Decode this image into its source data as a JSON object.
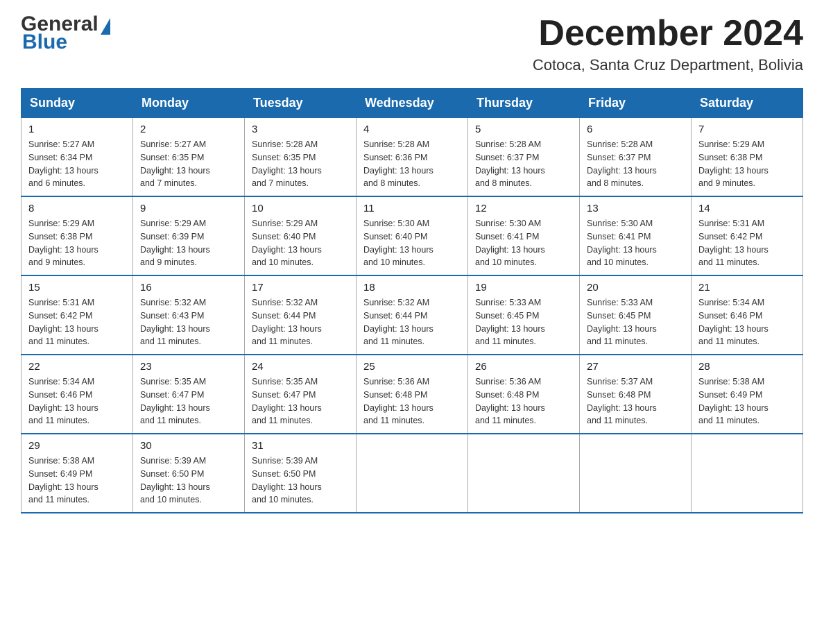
{
  "header": {
    "logo_general": "General",
    "logo_blue": "Blue",
    "title": "December 2024",
    "subtitle": "Cotoca, Santa Cruz Department, Bolivia"
  },
  "weekdays": [
    "Sunday",
    "Monday",
    "Tuesday",
    "Wednesday",
    "Thursday",
    "Friday",
    "Saturday"
  ],
  "weeks": [
    [
      {
        "day": "1",
        "sunrise": "5:27 AM",
        "sunset": "6:34 PM",
        "daylight": "13 hours and 6 minutes."
      },
      {
        "day": "2",
        "sunrise": "5:27 AM",
        "sunset": "6:35 PM",
        "daylight": "13 hours and 7 minutes."
      },
      {
        "day": "3",
        "sunrise": "5:28 AM",
        "sunset": "6:35 PM",
        "daylight": "13 hours and 7 minutes."
      },
      {
        "day": "4",
        "sunrise": "5:28 AM",
        "sunset": "6:36 PM",
        "daylight": "13 hours and 8 minutes."
      },
      {
        "day": "5",
        "sunrise": "5:28 AM",
        "sunset": "6:37 PM",
        "daylight": "13 hours and 8 minutes."
      },
      {
        "day": "6",
        "sunrise": "5:28 AM",
        "sunset": "6:37 PM",
        "daylight": "13 hours and 8 minutes."
      },
      {
        "day": "7",
        "sunrise": "5:29 AM",
        "sunset": "6:38 PM",
        "daylight": "13 hours and 9 minutes."
      }
    ],
    [
      {
        "day": "8",
        "sunrise": "5:29 AM",
        "sunset": "6:38 PM",
        "daylight": "13 hours and 9 minutes."
      },
      {
        "day": "9",
        "sunrise": "5:29 AM",
        "sunset": "6:39 PM",
        "daylight": "13 hours and 9 minutes."
      },
      {
        "day": "10",
        "sunrise": "5:29 AM",
        "sunset": "6:40 PM",
        "daylight": "13 hours and 10 minutes."
      },
      {
        "day": "11",
        "sunrise": "5:30 AM",
        "sunset": "6:40 PM",
        "daylight": "13 hours and 10 minutes."
      },
      {
        "day": "12",
        "sunrise": "5:30 AM",
        "sunset": "6:41 PM",
        "daylight": "13 hours and 10 minutes."
      },
      {
        "day": "13",
        "sunrise": "5:30 AM",
        "sunset": "6:41 PM",
        "daylight": "13 hours and 10 minutes."
      },
      {
        "day": "14",
        "sunrise": "5:31 AM",
        "sunset": "6:42 PM",
        "daylight": "13 hours and 11 minutes."
      }
    ],
    [
      {
        "day": "15",
        "sunrise": "5:31 AM",
        "sunset": "6:42 PM",
        "daylight": "13 hours and 11 minutes."
      },
      {
        "day": "16",
        "sunrise": "5:32 AM",
        "sunset": "6:43 PM",
        "daylight": "13 hours and 11 minutes."
      },
      {
        "day": "17",
        "sunrise": "5:32 AM",
        "sunset": "6:44 PM",
        "daylight": "13 hours and 11 minutes."
      },
      {
        "day": "18",
        "sunrise": "5:32 AM",
        "sunset": "6:44 PM",
        "daylight": "13 hours and 11 minutes."
      },
      {
        "day": "19",
        "sunrise": "5:33 AM",
        "sunset": "6:45 PM",
        "daylight": "13 hours and 11 minutes."
      },
      {
        "day": "20",
        "sunrise": "5:33 AM",
        "sunset": "6:45 PM",
        "daylight": "13 hours and 11 minutes."
      },
      {
        "day": "21",
        "sunrise": "5:34 AM",
        "sunset": "6:46 PM",
        "daylight": "13 hours and 11 minutes."
      }
    ],
    [
      {
        "day": "22",
        "sunrise": "5:34 AM",
        "sunset": "6:46 PM",
        "daylight": "13 hours and 11 minutes."
      },
      {
        "day": "23",
        "sunrise": "5:35 AM",
        "sunset": "6:47 PM",
        "daylight": "13 hours and 11 minutes."
      },
      {
        "day": "24",
        "sunrise": "5:35 AM",
        "sunset": "6:47 PM",
        "daylight": "13 hours and 11 minutes."
      },
      {
        "day": "25",
        "sunrise": "5:36 AM",
        "sunset": "6:48 PM",
        "daylight": "13 hours and 11 minutes."
      },
      {
        "day": "26",
        "sunrise": "5:36 AM",
        "sunset": "6:48 PM",
        "daylight": "13 hours and 11 minutes."
      },
      {
        "day": "27",
        "sunrise": "5:37 AM",
        "sunset": "6:48 PM",
        "daylight": "13 hours and 11 minutes."
      },
      {
        "day": "28",
        "sunrise": "5:38 AM",
        "sunset": "6:49 PM",
        "daylight": "13 hours and 11 minutes."
      }
    ],
    [
      {
        "day": "29",
        "sunrise": "5:38 AM",
        "sunset": "6:49 PM",
        "daylight": "13 hours and 11 minutes."
      },
      {
        "day": "30",
        "sunrise": "5:39 AM",
        "sunset": "6:50 PM",
        "daylight": "13 hours and 10 minutes."
      },
      {
        "day": "31",
        "sunrise": "5:39 AM",
        "sunset": "6:50 PM",
        "daylight": "13 hours and 10 minutes."
      },
      null,
      null,
      null,
      null
    ]
  ],
  "labels": {
    "sunrise": "Sunrise:",
    "sunset": "Sunset:",
    "daylight": "Daylight:"
  }
}
